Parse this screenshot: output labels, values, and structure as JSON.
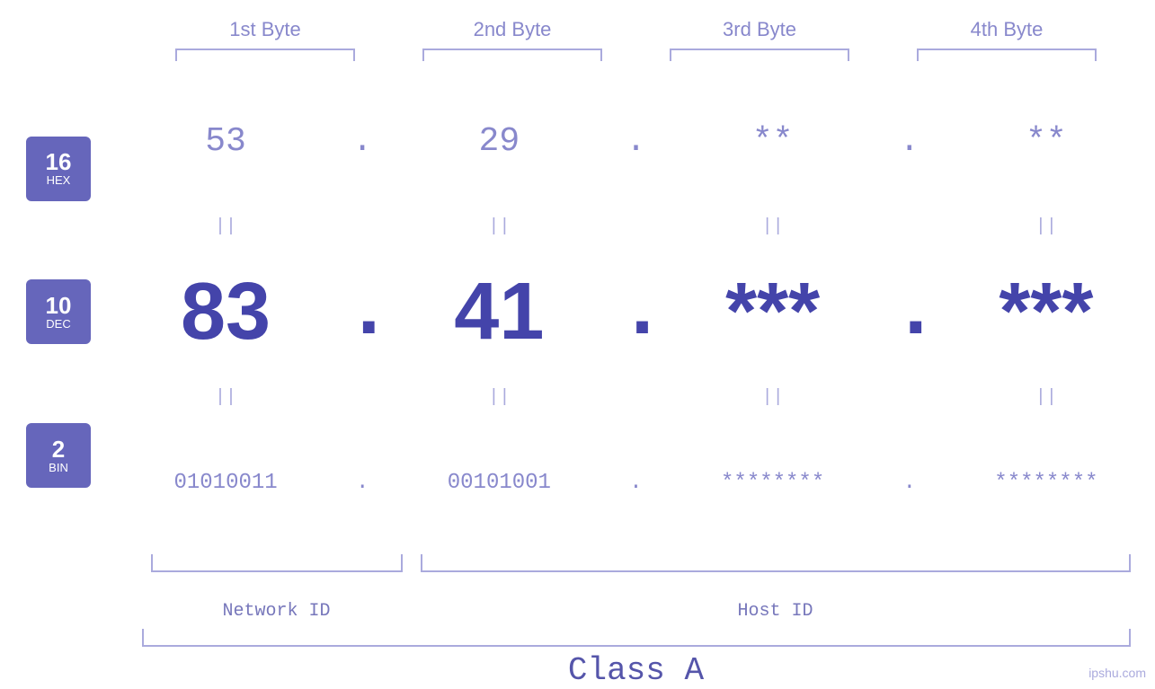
{
  "bytes": {
    "headers": [
      "1st Byte",
      "2nd Byte",
      "3rd Byte",
      "4th Byte"
    ]
  },
  "bases": [
    {
      "num": "16",
      "name": "HEX"
    },
    {
      "num": "10",
      "name": "DEC"
    },
    {
      "num": "2",
      "name": "BIN"
    }
  ],
  "hex_values": [
    "53",
    "29",
    "**",
    "**"
  ],
  "dec_values": [
    "83",
    "41",
    "***",
    "***"
  ],
  "bin_values": [
    "01010011",
    "00101001",
    "********",
    "********"
  ],
  "dots": [
    ".",
    ".",
    ".",
    ""
  ],
  "equals": [
    "||",
    "||",
    "||",
    "||"
  ],
  "network_id_label": "Network ID",
  "host_id_label": "Host ID",
  "class_label": "Class A",
  "watermark": "ipshu.com"
}
